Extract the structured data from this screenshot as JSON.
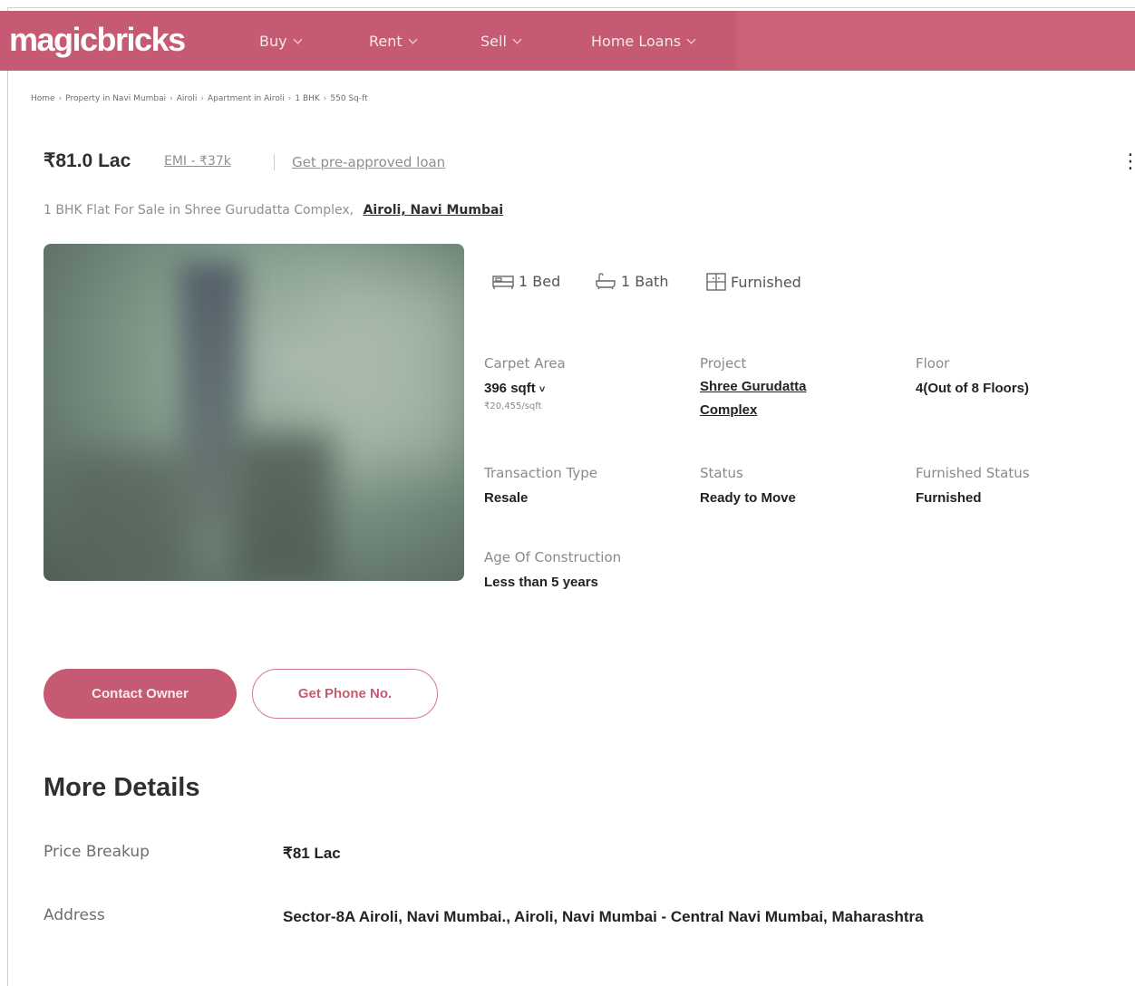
{
  "header": {
    "logo": "magicbricks",
    "nav": [
      {
        "label": "Buy"
      },
      {
        "label": "Rent"
      },
      {
        "label": "Sell"
      },
      {
        "label": "Home Loans"
      }
    ],
    "brand_color": "#c65a72"
  },
  "breadcrumb": [
    "Home",
    "Property in Navi Mumbai",
    "Airoli",
    "Apartment in Airoli",
    "1 BHK",
    "550 Sq-ft"
  ],
  "listing": {
    "price": "₹81.0 Lac",
    "emi": "EMI - ₹37k",
    "loan_link": "Get pre-approved loan",
    "title": "1 BHK Flat For Sale in Shree Gurudatta Complex,",
    "location": "Airoli, Navi Mumbai"
  },
  "amenities": {
    "bed": "1 Bed",
    "bath": "1 Bath",
    "furnishing": "Furnished"
  },
  "details": {
    "carpet_area": {
      "label": "Carpet Area",
      "value": "396 sqft",
      "sub": "₹20,455/sqft"
    },
    "project": {
      "label": "Project",
      "value_line1": "Shree Gurudatta",
      "value_line2": "Complex"
    },
    "floor": {
      "label": "Floor",
      "value": "4(Out of 8 Floors)"
    },
    "transaction": {
      "label": "Transaction Type",
      "value": "Resale"
    },
    "status": {
      "label": "Status",
      "value": "Ready to Move"
    },
    "furnished_status": {
      "label": "Furnished Status",
      "value": "Furnished"
    },
    "age": {
      "label": "Age Of Construction",
      "value": "Less than 5 years"
    }
  },
  "actions": {
    "contact": "Contact Owner",
    "phone": "Get Phone No."
  },
  "more_details": {
    "title": "More Details",
    "rows": [
      {
        "label": "Price Breakup",
        "value": "₹81 Lac"
      },
      {
        "label": "Address",
        "value": "Sector-8A Airoli, Navi Mumbai., Airoli, Navi Mumbai - Central Navi Mumbai, Maharashtra"
      }
    ]
  }
}
